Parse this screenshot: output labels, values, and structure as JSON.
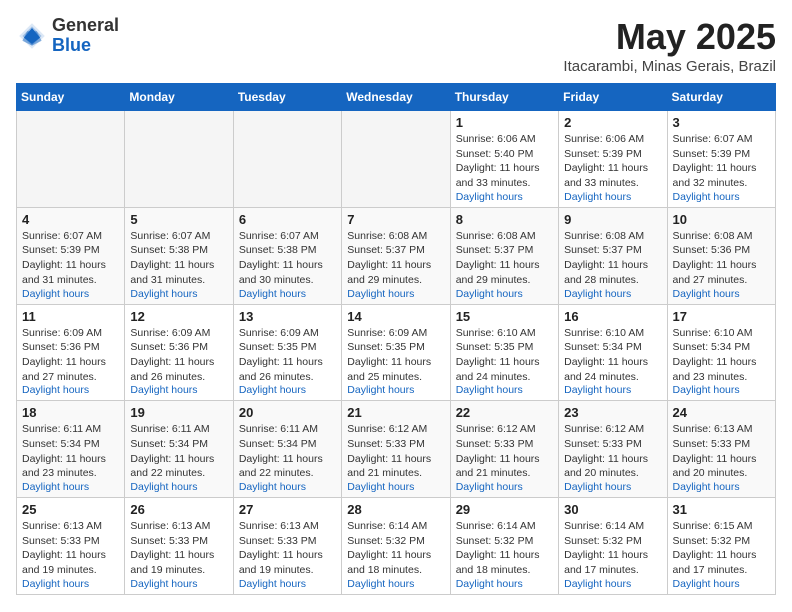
{
  "header": {
    "logo": {
      "general": "General",
      "blue": "Blue"
    },
    "title": "May 2025",
    "location": "Itacarambi, Minas Gerais, Brazil"
  },
  "weekdays": [
    "Sunday",
    "Monday",
    "Tuesday",
    "Wednesday",
    "Thursday",
    "Friday",
    "Saturday"
  ],
  "weeks": [
    [
      {
        "day": "",
        "empty": true
      },
      {
        "day": "",
        "empty": true
      },
      {
        "day": "",
        "empty": true
      },
      {
        "day": "",
        "empty": true
      },
      {
        "day": "1",
        "sunrise": "Sunrise: 6:06 AM",
        "sunset": "Sunset: 5:40 PM",
        "daylight": "Daylight: 11 hours and 33 minutes."
      },
      {
        "day": "2",
        "sunrise": "Sunrise: 6:06 AM",
        "sunset": "Sunset: 5:39 PM",
        "daylight": "Daylight: 11 hours and 33 minutes."
      },
      {
        "day": "3",
        "sunrise": "Sunrise: 6:07 AM",
        "sunset": "Sunset: 5:39 PM",
        "daylight": "Daylight: 11 hours and 32 minutes."
      }
    ],
    [
      {
        "day": "4",
        "sunrise": "Sunrise: 6:07 AM",
        "sunset": "Sunset: 5:39 PM",
        "daylight": "Daylight: 11 hours and 31 minutes."
      },
      {
        "day": "5",
        "sunrise": "Sunrise: 6:07 AM",
        "sunset": "Sunset: 5:38 PM",
        "daylight": "Daylight: 11 hours and 31 minutes."
      },
      {
        "day": "6",
        "sunrise": "Sunrise: 6:07 AM",
        "sunset": "Sunset: 5:38 PM",
        "daylight": "Daylight: 11 hours and 30 minutes."
      },
      {
        "day": "7",
        "sunrise": "Sunrise: 6:08 AM",
        "sunset": "Sunset: 5:37 PM",
        "daylight": "Daylight: 11 hours and 29 minutes."
      },
      {
        "day": "8",
        "sunrise": "Sunrise: 6:08 AM",
        "sunset": "Sunset: 5:37 PM",
        "daylight": "Daylight: 11 hours and 29 minutes."
      },
      {
        "day": "9",
        "sunrise": "Sunrise: 6:08 AM",
        "sunset": "Sunset: 5:37 PM",
        "daylight": "Daylight: 11 hours and 28 minutes."
      },
      {
        "day": "10",
        "sunrise": "Sunrise: 6:08 AM",
        "sunset": "Sunset: 5:36 PM",
        "daylight": "Daylight: 11 hours and 27 minutes."
      }
    ],
    [
      {
        "day": "11",
        "sunrise": "Sunrise: 6:09 AM",
        "sunset": "Sunset: 5:36 PM",
        "daylight": "Daylight: 11 hours and 27 minutes."
      },
      {
        "day": "12",
        "sunrise": "Sunrise: 6:09 AM",
        "sunset": "Sunset: 5:36 PM",
        "daylight": "Daylight: 11 hours and 26 minutes."
      },
      {
        "day": "13",
        "sunrise": "Sunrise: 6:09 AM",
        "sunset": "Sunset: 5:35 PM",
        "daylight": "Daylight: 11 hours and 26 minutes."
      },
      {
        "day": "14",
        "sunrise": "Sunrise: 6:09 AM",
        "sunset": "Sunset: 5:35 PM",
        "daylight": "Daylight: 11 hours and 25 minutes."
      },
      {
        "day": "15",
        "sunrise": "Sunrise: 6:10 AM",
        "sunset": "Sunset: 5:35 PM",
        "daylight": "Daylight: 11 hours and 24 minutes."
      },
      {
        "day": "16",
        "sunrise": "Sunrise: 6:10 AM",
        "sunset": "Sunset: 5:34 PM",
        "daylight": "Daylight: 11 hours and 24 minutes."
      },
      {
        "day": "17",
        "sunrise": "Sunrise: 6:10 AM",
        "sunset": "Sunset: 5:34 PM",
        "daylight": "Daylight: 11 hours and 23 minutes."
      }
    ],
    [
      {
        "day": "18",
        "sunrise": "Sunrise: 6:11 AM",
        "sunset": "Sunset: 5:34 PM",
        "daylight": "Daylight: 11 hours and 23 minutes."
      },
      {
        "day": "19",
        "sunrise": "Sunrise: 6:11 AM",
        "sunset": "Sunset: 5:34 PM",
        "daylight": "Daylight: 11 hours and 22 minutes."
      },
      {
        "day": "20",
        "sunrise": "Sunrise: 6:11 AM",
        "sunset": "Sunset: 5:34 PM",
        "daylight": "Daylight: 11 hours and 22 minutes."
      },
      {
        "day": "21",
        "sunrise": "Sunrise: 6:12 AM",
        "sunset": "Sunset: 5:33 PM",
        "daylight": "Daylight: 11 hours and 21 minutes."
      },
      {
        "day": "22",
        "sunrise": "Sunrise: 6:12 AM",
        "sunset": "Sunset: 5:33 PM",
        "daylight": "Daylight: 11 hours and 21 minutes."
      },
      {
        "day": "23",
        "sunrise": "Sunrise: 6:12 AM",
        "sunset": "Sunset: 5:33 PM",
        "daylight": "Daylight: 11 hours and 20 minutes."
      },
      {
        "day": "24",
        "sunrise": "Sunrise: 6:13 AM",
        "sunset": "Sunset: 5:33 PM",
        "daylight": "Daylight: 11 hours and 20 minutes."
      }
    ],
    [
      {
        "day": "25",
        "sunrise": "Sunrise: 6:13 AM",
        "sunset": "Sunset: 5:33 PM",
        "daylight": "Daylight: 11 hours and 19 minutes."
      },
      {
        "day": "26",
        "sunrise": "Sunrise: 6:13 AM",
        "sunset": "Sunset: 5:33 PM",
        "daylight": "Daylight: 11 hours and 19 minutes."
      },
      {
        "day": "27",
        "sunrise": "Sunrise: 6:13 AM",
        "sunset": "Sunset: 5:33 PM",
        "daylight": "Daylight: 11 hours and 19 minutes."
      },
      {
        "day": "28",
        "sunrise": "Sunrise: 6:14 AM",
        "sunset": "Sunset: 5:32 PM",
        "daylight": "Daylight: 11 hours and 18 minutes."
      },
      {
        "day": "29",
        "sunrise": "Sunrise: 6:14 AM",
        "sunset": "Sunset: 5:32 PM",
        "daylight": "Daylight: 11 hours and 18 minutes."
      },
      {
        "day": "30",
        "sunrise": "Sunrise: 6:14 AM",
        "sunset": "Sunset: 5:32 PM",
        "daylight": "Daylight: 11 hours and 17 minutes."
      },
      {
        "day": "31",
        "sunrise": "Sunrise: 6:15 AM",
        "sunset": "Sunset: 5:32 PM",
        "daylight": "Daylight: 11 hours and 17 minutes."
      }
    ]
  ]
}
